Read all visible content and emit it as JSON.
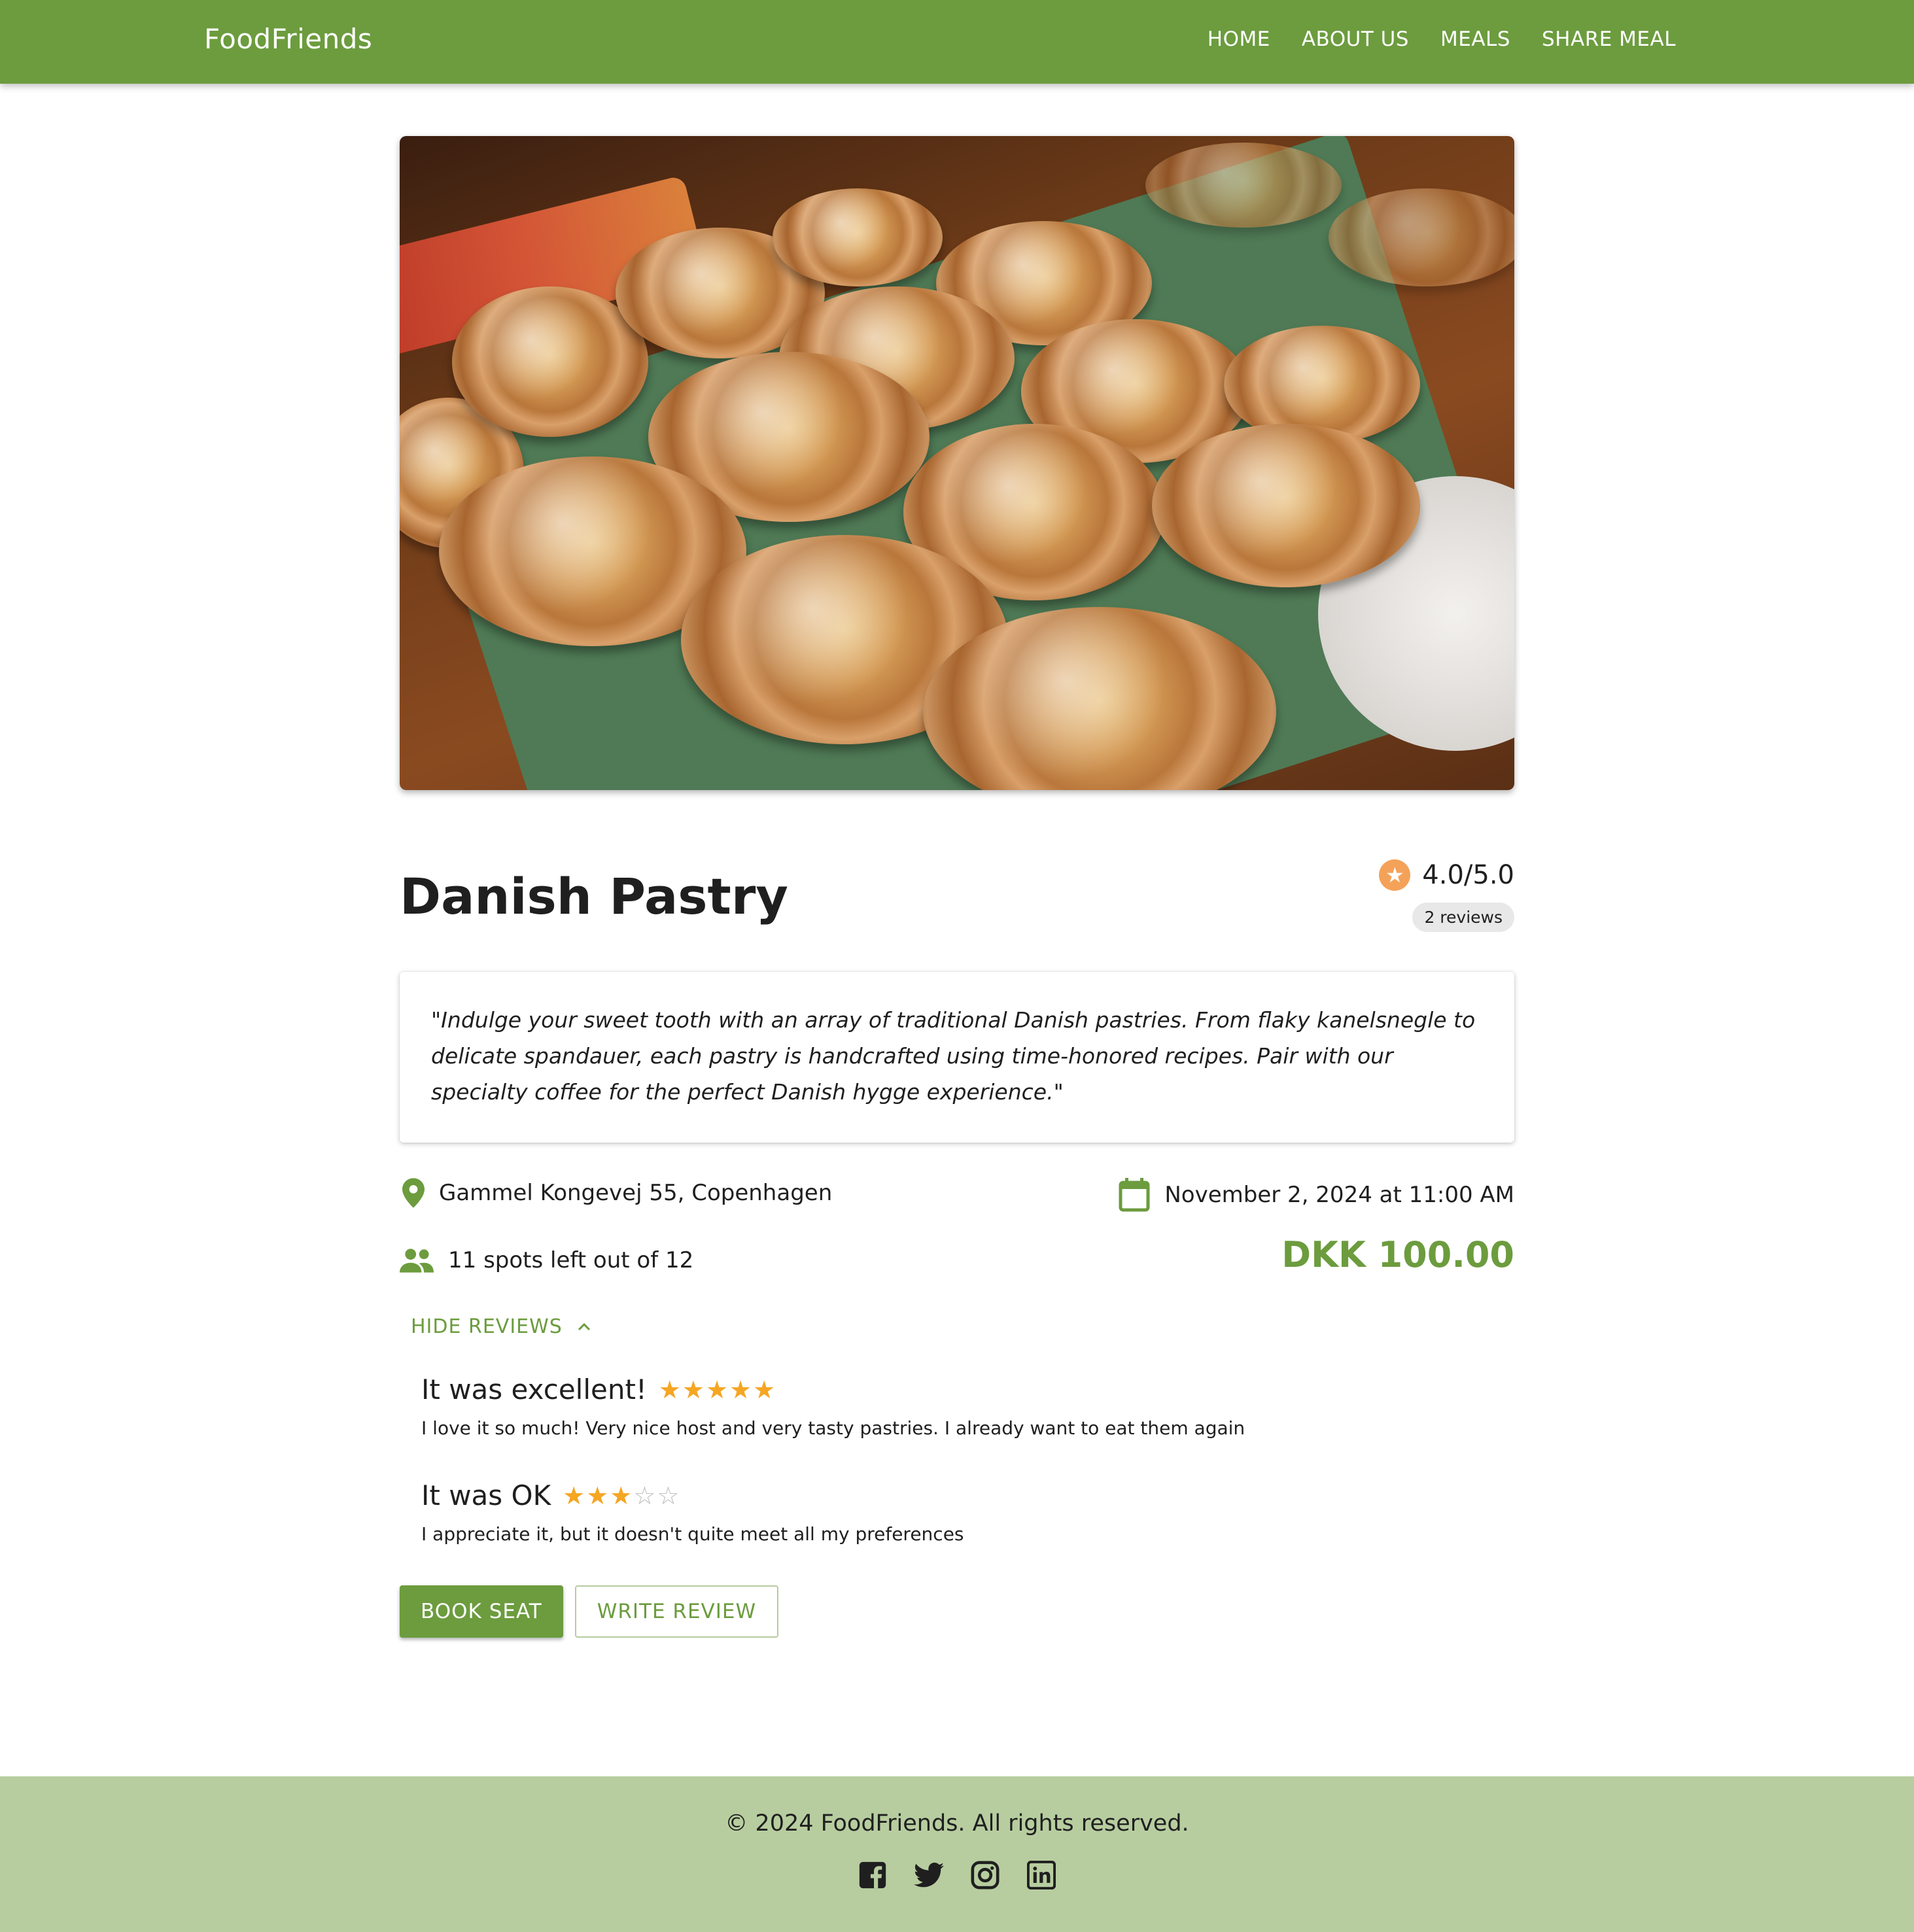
{
  "header": {
    "brand": "FoodFriends",
    "nav": [
      {
        "label": "HOME"
      },
      {
        "label": "ABOUT US"
      },
      {
        "label": "MEALS"
      },
      {
        "label": "SHARE MEAL"
      }
    ]
  },
  "colors": {
    "primary": "#6c9c3e",
    "footer": "#b7cd9f",
    "star": "#f5a623",
    "rating_badge": "#f4a259"
  },
  "meal": {
    "title": "Danish Pastry",
    "rating": "4.0/5.0",
    "reviews_count": "2 reviews",
    "description": "\"Indulge your sweet tooth with an array of traditional Danish pastries. From flaky kanelsnegle to delicate spandauer, each pastry is handcrafted using time-honored recipes. Pair with our specialty coffee for the perfect Danish hygge experience.\"",
    "location": "Gammel Kongevej 55, Copenhagen",
    "datetime": "November 2, 2024 at 11:00 AM",
    "spots": "11 spots left out of 12",
    "price": "DKK 100.00"
  },
  "reviews_toggle": "HIDE REVIEWS",
  "reviews": [
    {
      "title": "It was excellent!",
      "stars": 5,
      "text": "I love it so much! Very nice host and very tasty pastries. I already want to eat them again"
    },
    {
      "title": "It was OK",
      "stars": 3,
      "text": "I appreciate it, but it doesn't quite meet all my preferences"
    }
  ],
  "actions": {
    "book": "BOOK SEAT",
    "review": "WRITE REVIEW"
  },
  "footer": {
    "copyright": "© 2024 FoodFriends. All rights reserved.",
    "socials": [
      "facebook-icon",
      "twitter-icon",
      "instagram-icon",
      "linkedin-icon"
    ]
  }
}
